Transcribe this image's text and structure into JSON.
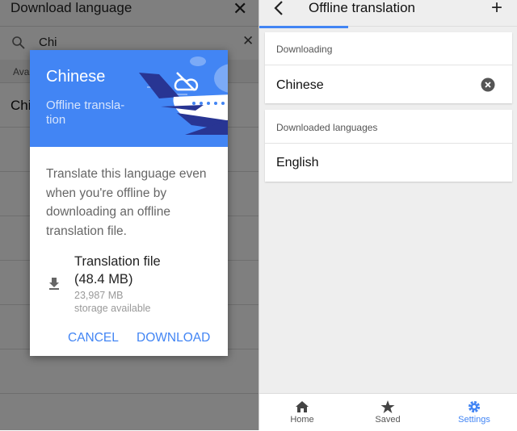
{
  "left": {
    "title": "Download language",
    "search_value": "Chi",
    "section_header": "Available languages",
    "list_item": "Chinese",
    "dialog": {
      "title": "Chinese",
      "subtitle": "Offline transla-\ntion",
      "body": "Translate this language even when you're offline by downloading an offline translation file.",
      "file_label": "Translation file (48.4 MB)",
      "storage_amount": "23,987 MB",
      "storage_label": "storage available",
      "cancel": "CANCEL",
      "download": "DOWNLOAD"
    }
  },
  "right": {
    "title": "Offline translation",
    "downloading_header": "Downloading",
    "downloading_item": "Chinese",
    "downloaded_header": "Downloaded languages",
    "downloaded_item": "English",
    "nav": [
      {
        "label": "Home",
        "icon": "home-icon"
      },
      {
        "label": "Saved",
        "icon": "star-icon"
      },
      {
        "label": "Settings",
        "icon": "gear-icon"
      }
    ]
  },
  "colors": {
    "accent": "#4285f4",
    "dark_blue": "#283593"
  }
}
